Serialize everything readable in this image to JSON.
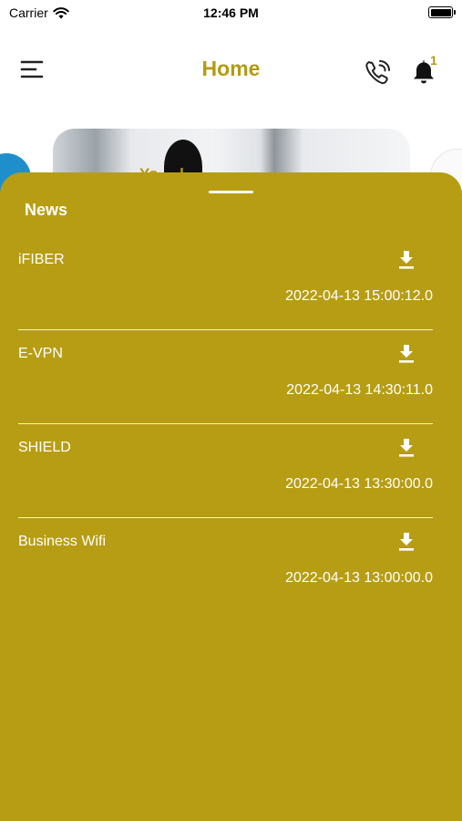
{
  "status_bar": {
    "carrier": "Carrier",
    "time": "12:46 PM"
  },
  "header": {
    "title": "Home",
    "menu_icon": "hamburger-menu-icon",
    "phone_icon": "phone-call-icon",
    "bell_icon": "bell-icon",
    "notification_count": "1"
  },
  "banner": {
    "partial_text": "Yo ... l"
  },
  "news": {
    "title": "News",
    "items": [
      {
        "title": "iFIBER",
        "date": "2022-04-13 15:00:12.0"
      },
      {
        "title": "E-VPN",
        "date": "2022-04-13 14:30:11.0"
      },
      {
        "title": "SHIELD",
        "date": "2022-04-13 13:30:00.0"
      },
      {
        "title": "Business Wifi",
        "date": "2022-04-13 13:00:00.0"
      }
    ]
  },
  "colors": {
    "accent": "#b49a12",
    "sheet_background": "#b79d13",
    "text_on_accent": "#ffffff"
  }
}
